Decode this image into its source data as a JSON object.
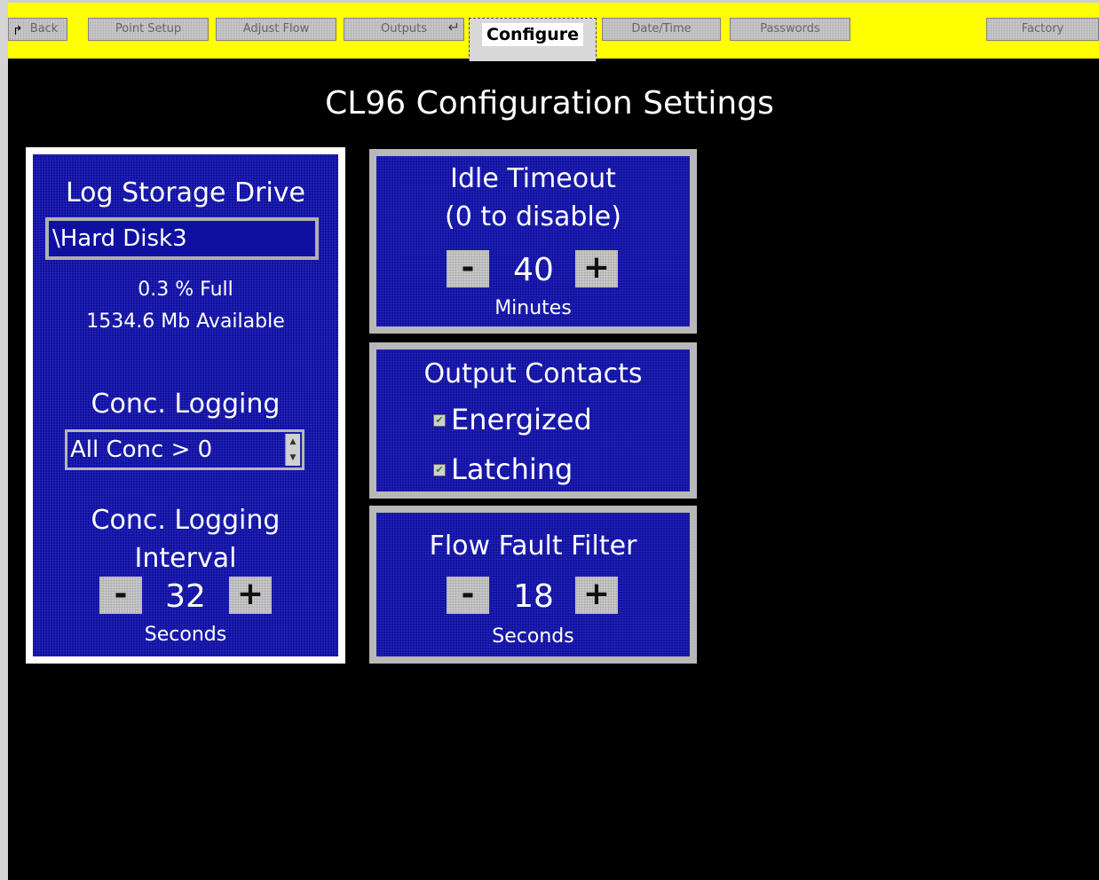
{
  "toolbar": {
    "back": "Back",
    "point_setup": "Point Setup",
    "adjust_flow": "Adjust Flow",
    "outputs": "Outputs",
    "configure": "Configure",
    "date_time": "Date/Time",
    "passwords": "Passwords",
    "factory": "Factory"
  },
  "page_title": "CL96 Configuration Settings",
  "log_storage": {
    "title": "Log Storage Drive",
    "drive": "\\Hard Disk3",
    "percent_full": "0.3 % Full",
    "available": "1534.6  Mb Available",
    "conc_logging_title": "Conc. Logging",
    "conc_logging_value": "All Conc > 0",
    "interval_title_1": "Conc. Logging",
    "interval_title_2": "Interval",
    "interval_value": "32",
    "interval_unit": "Seconds",
    "minus": "-",
    "plus": "+"
  },
  "idle_timeout": {
    "title_1": "Idle Timeout",
    "title_2": "(0 to disable)",
    "value": "40",
    "unit": "Minutes",
    "minus": "-",
    "plus": "+"
  },
  "output_contacts": {
    "title": "Output Contacts",
    "energized": "Energized",
    "energized_checked": true,
    "latching": "Latching",
    "latching_checked": true,
    "check_mark": "✔"
  },
  "flow_fault": {
    "title": "Flow Fault Filter",
    "value": "18",
    "unit": "Seconds",
    "minus": "-",
    "plus": "+"
  },
  "colors": {
    "toolbar": "#ffff00",
    "panel": "#1010a0",
    "background": "#000000"
  }
}
